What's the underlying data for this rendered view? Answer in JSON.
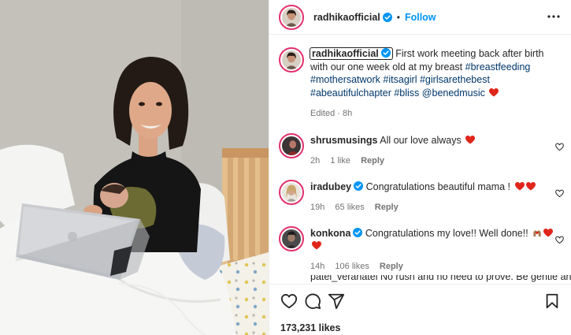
{
  "post": {
    "username": "radhikaofficial",
    "follow_label": "Follow",
    "separator": "•",
    "caption": {
      "username": "radhikaofficial",
      "text": "First work meeting back after birth with our one week old at my breast",
      "hashtags": [
        "#breastfeeding",
        "#mothersatwork",
        "#itsagirl",
        "#girlsarethebest",
        "#abeautifulchapter",
        "#bliss"
      ],
      "mention": "@benedmusic",
      "emoji": "heart",
      "meta": "Edited · 8h"
    },
    "likes": "173,231 likes"
  },
  "comments": [
    {
      "username": "shrusmusings",
      "text": "All our love always",
      "emoji_count": 1,
      "time": "2h",
      "likes": "1 like",
      "reply": "Reply",
      "verified": false
    },
    {
      "username": "iradubey",
      "text": "Congratulations beautiful mama !",
      "emoji_count": 2,
      "time": "19h",
      "likes": "65 likes",
      "reply": "Reply",
      "verified": true
    },
    {
      "username": "konkona",
      "text": "Congratulations my love!! Well done!!",
      "emoji_count": 2,
      "time": "14h",
      "likes": "106 likes",
      "reply": "Reply",
      "verified": true
    }
  ],
  "partial_comment": "patel_veranatel No rush and no need to prove. Be gentle and",
  "icons": [
    "more-options-icon",
    "verified-badge-icon",
    "heart-icon",
    "comment-icon",
    "share-icon",
    "save-bookmark-icon"
  ],
  "colors": {
    "accent": "#0095f6",
    "ring": "#e1306c",
    "heart": "#e0261b",
    "hashtag": "#00376b",
    "muted": "#737373"
  }
}
